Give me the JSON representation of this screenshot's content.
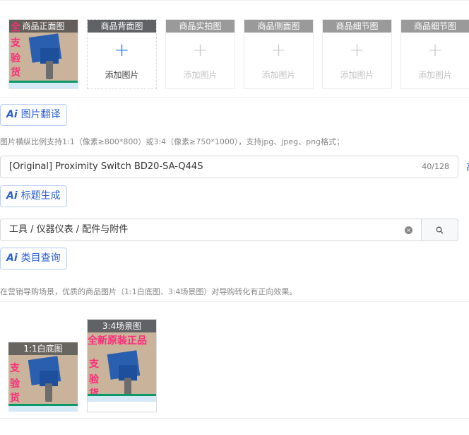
{
  "image_slots": [
    {
      "label": "商品正面图",
      "state": "filled"
    },
    {
      "label": "商品背面图",
      "state": "active",
      "add_text": "添加图片"
    },
    {
      "label": "商品实拍图",
      "state": "disabled",
      "add_text": "添加图片"
    },
    {
      "label": "商品侧面图",
      "state": "disabled",
      "add_text": "添加图片"
    },
    {
      "label": "商品细节图",
      "state": "disabled",
      "add_text": "添加图片"
    },
    {
      "label": "商品细节图",
      "state": "disabled",
      "add_text": "添加图片"
    }
  ],
  "image_translate": {
    "ai_logo": "Ai",
    "label": "图片翻译"
  },
  "image_hint": "图片横纵比例支持1:1（像素≥800*800）或3:4（像素≥750*1000），支持jpg、jpeg、png格式；",
  "title_field": {
    "value": "[Original] Proximity Switch BD20-SA-Q44S",
    "count": "40/128",
    "edge_char": "高"
  },
  "title_generate": {
    "ai_logo": "Ai",
    "label": "标题生成"
  },
  "category_field": {
    "value": "工具 / 仪器仪表 / 配件与附件",
    "clear_icon": "×"
  },
  "category_query": {
    "ai_logo": "Ai",
    "label": "类目查询"
  },
  "marketing_hint": "在营销导购场景，优质的商品图片（1:1白底图、3:4场景图）对导购转化有正向效果。",
  "scene_images": [
    {
      "label": "1:1白底图"
    },
    {
      "label": "3:4场景图"
    }
  ],
  "photo_text": {
    "char1": "全",
    "char2": "支",
    "char3": "验",
    "char4": "货",
    "banner": "全新原装正品"
  },
  "colors": {
    "accent": "#1677ff",
    "ai_blue": "#2a5fd6",
    "header_gray": "#606266",
    "promo_pink": "#ff2a7a"
  }
}
